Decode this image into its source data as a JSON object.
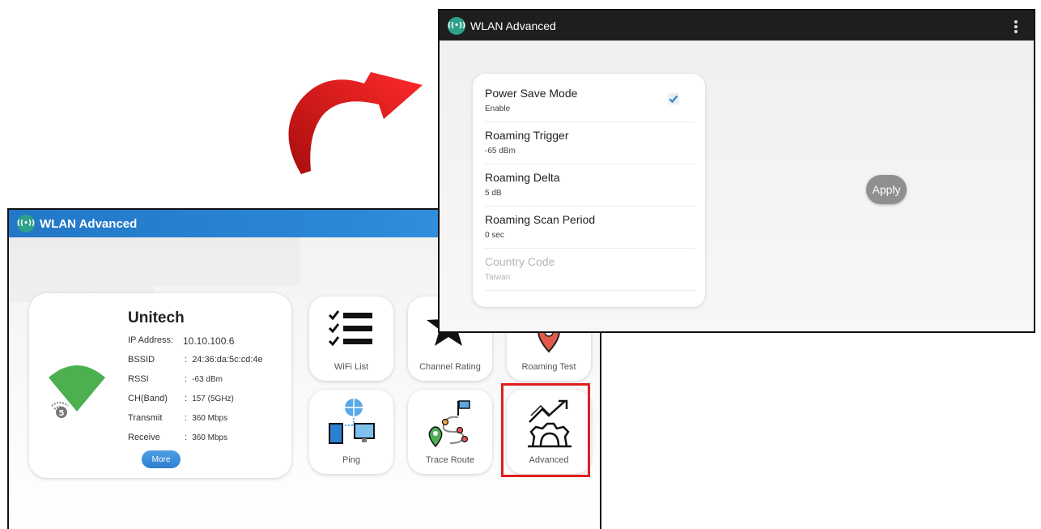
{
  "main": {
    "app_title": "WLAN Advanced",
    "network": {
      "ssid": "Unitech",
      "rows": [
        {
          "label": "IP Address",
          "sep": ":",
          "value": "10.10.100.6"
        },
        {
          "label": "BSSID",
          "sep": ":",
          "value": "24:36:da:5c:cd:4e"
        },
        {
          "label": "RSSI",
          "sep": ":",
          "value": "-63 dBm"
        },
        {
          "label": "CH(Band)",
          "sep": ":",
          "value": "157 (5GHz)"
        },
        {
          "label": "Transmit",
          "sep": ":",
          "value": "360 Mbps"
        },
        {
          "label": "Receive",
          "sep": ":",
          "value": "360 Mbps"
        }
      ],
      "band_badge": "5",
      "more_label": "More"
    },
    "tiles": [
      {
        "label": "WiFi List",
        "icon": "checklist-icon"
      },
      {
        "label": "Channel Rating",
        "icon": "star-icon"
      },
      {
        "label": "Roaming Test",
        "icon": "map-pin-icon"
      },
      {
        "label": "Ping",
        "icon": "network-ping-icon"
      },
      {
        "label": "Trace Route",
        "icon": "route-icon"
      },
      {
        "label": "Advanced",
        "icon": "gear-growth-icon"
      }
    ],
    "highlighted_tile": "Advanced"
  },
  "advanced": {
    "app_title": "WLAN Advanced",
    "settings": [
      {
        "title": "Power Save Mode",
        "value": "Enable",
        "checked": true,
        "enabled": true
      },
      {
        "title": "Roaming Trigger",
        "value": "-65 dBm",
        "enabled": true
      },
      {
        "title": "Roaming Delta",
        "value": "5 dB",
        "enabled": true
      },
      {
        "title": "Roaming Scan Period",
        "value": "0 sec",
        "enabled": true
      },
      {
        "title": "Country Code",
        "value": "Taiwan",
        "enabled": false
      }
    ],
    "apply_label": "Apply"
  },
  "colors": {
    "appbar_blue": "#2b89d8",
    "appbar_dark": "#1e1e1e",
    "signal_green": "#4caf50",
    "highlight_red": "#e01f1f",
    "arrow_red": "#d81515",
    "checkbox_blue": "#2a7fc9"
  }
}
